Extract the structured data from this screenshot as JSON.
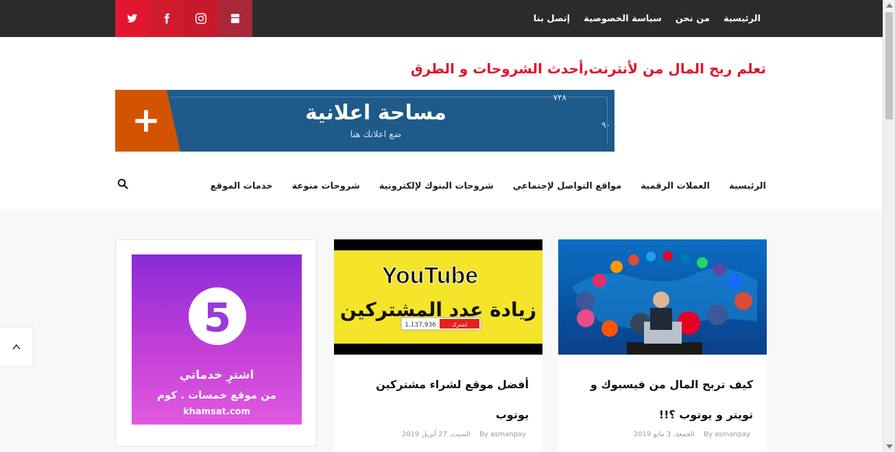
{
  "topbar": {
    "links": [
      "الرئيسية",
      "من نحن",
      "سياسة الخصوصية",
      "إتصل بنا"
    ],
    "social": [
      "twitter-icon",
      "facebook-icon",
      "instagram-icon",
      "youtube-icon"
    ]
  },
  "tagline": "تعلم ربح المال من لأنترنت,أحدث الشروحات و الطرق",
  "banner": {
    "plus": "+",
    "title": "مساحة اعلانية",
    "subtitle": "ضع اعلانك هنا",
    "width_label": "٧٢٨",
    "height_label": "٩٠"
  },
  "nav": {
    "items": [
      "الرئيسية",
      "العملات الرقمية",
      "مواقع التواصل لإجتماعي",
      "شروحات البنوك لإلكترونية",
      "شروحات منوعة",
      "خدمات الموقع"
    ]
  },
  "posts": [
    {
      "title": "كيف تربح المال من فيسبوك و تويتر و يوتوب ؟!!",
      "author": "By asmanpay",
      "date": "الجمعة, 3 مايو 2019"
    },
    {
      "title": "أفضل موقع لشراء مشتركين يوتوب",
      "author": "By asmanpay",
      "date": "السبت, 27 أبريل 2019",
      "image_text_brand": "YouTube",
      "image_text_main": "زيادة عدد المشتركين",
      "image_text_count": "1,137,936",
      "image_text_button": "اشترك"
    }
  ],
  "ad": {
    "logo": "5",
    "line1": "اشترِ خدماتي",
    "line2": "من موقع خمسات . كوم",
    "line3": "khamsat.com"
  },
  "colors": {
    "accent": "#e1142d",
    "topbar": "#2b2b2b",
    "banner": "#1e5a8a"
  }
}
